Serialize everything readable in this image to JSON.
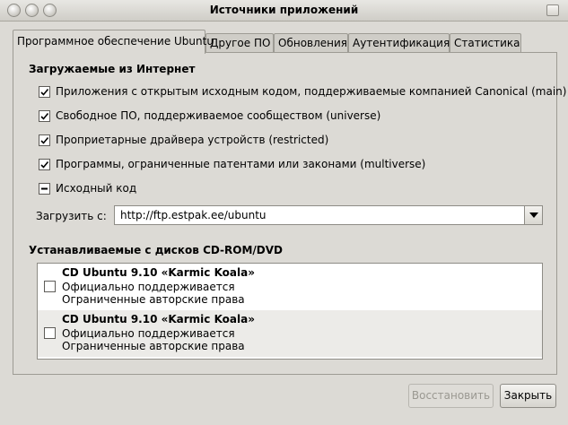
{
  "window": {
    "title": "Источники приложений"
  },
  "tabs": [
    {
      "label": "Программное обеспечение Ubuntu"
    },
    {
      "label": "Другое ПО"
    },
    {
      "label": "Обновления"
    },
    {
      "label": "Аутентификация"
    },
    {
      "label": "Статистика"
    }
  ],
  "internet": {
    "title": "Загружаемые из Интернет",
    "items": [
      {
        "label": "Приложения с открытым исходным кодом, поддерживаемые компанией Canonical (main)",
        "state": "checked"
      },
      {
        "label": "Свободное ПО, поддерживаемое сообществом (universe)",
        "state": "checked"
      },
      {
        "label": "Проприетарные драйвера устройств (restricted)",
        "state": "checked"
      },
      {
        "label": "Программы, ограниченные патентами или законами (multiverse)",
        "state": "checked"
      },
      {
        "label": "Исходный код",
        "state": "mixed"
      }
    ],
    "download_label": "Загрузить с:",
    "download_value": "http://ftp.estpak.ee/ubuntu"
  },
  "cdrom": {
    "title": "Устанавливаемые с дисков CD-ROM/DVD",
    "items": [
      {
        "title": "CD Ubuntu 9.10 «Karmic Koala»",
        "line1": "Официально поддерживается",
        "line2": "Ограниченные авторские права",
        "checked": false
      },
      {
        "title": "CD Ubuntu 9.10 «Karmic Koala»",
        "line1": "Официально поддерживается",
        "line2": "Ограниченные авторские права",
        "checked": false
      }
    ]
  },
  "buttons": {
    "restore": "Восстановить",
    "close": "Закрыть"
  }
}
